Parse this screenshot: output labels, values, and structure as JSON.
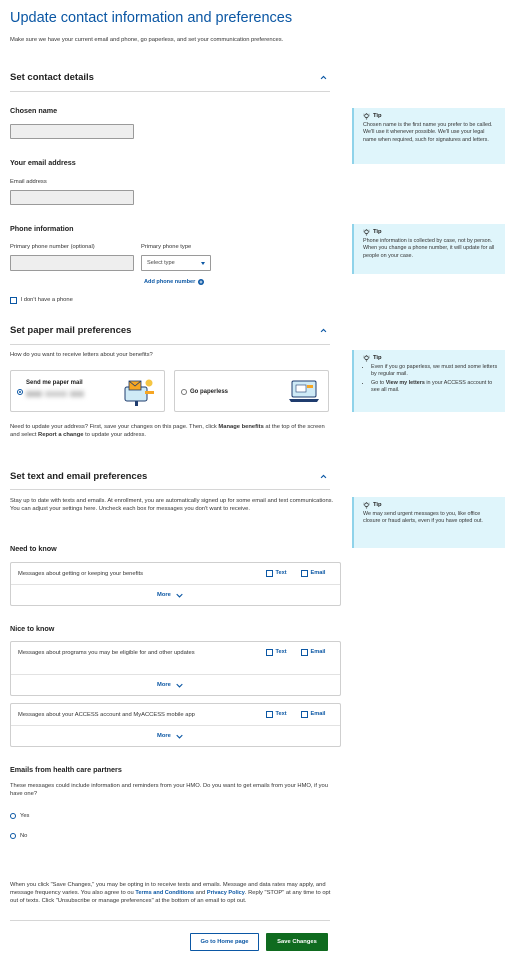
{
  "page": {
    "title": "Update contact information and preferences",
    "intro": "Make sure we have your current email and phone, go paperless, and set your communication preferences."
  },
  "contact": {
    "section_title": "Set contact details",
    "chosen_name_label": "Chosen name",
    "chosen_name_value": "",
    "email_heading": "Your email address",
    "email_label": "Email address",
    "email_value": "",
    "phone_heading": "Phone information",
    "primary_phone_label": "Primary phone number (optional)",
    "primary_phone_value": "",
    "phone_type_label": "Primary phone type",
    "phone_type_value": "Select type",
    "add_phone_link": "Add phone number",
    "no_phone_label": "I don't have a phone",
    "no_phone_checked": false
  },
  "tips": {
    "label": "Tip",
    "chosen_name": "Chosen name is the first name you prefer to be called. We'll use it whenever possible. We'll use your legal name when required, such for signatures and letters.",
    "phone": "Phone information is collected by case, not by person. When you change a phone number, it will update for all people on your case.",
    "paperless_1": "Even if you go paperless, we must send some letters by regular mail.",
    "paperless_2_pre": "Go to ",
    "paperless_2_link": "View my letters",
    "paperless_2_post": " in your ACCESS account to see all mail.",
    "text_email": "We may send urgent messages to you, like office closure or fraud alerts, even if you have opted out."
  },
  "paper": {
    "section_title": "Set paper mail preferences",
    "question": "How do you want to receive letters about your benefits?",
    "option_mail": "Send me paper mail",
    "option_paperless": "Go paperless",
    "selected": "mail",
    "address_note_1": "Need to update your address? First, save your changes on this page. Then, click ",
    "address_note_b1": "Manage benefits",
    "address_note_2": " at the top of the screen and select ",
    "address_note_b2": "Report a change",
    "address_note_3": " to update your address."
  },
  "textemail": {
    "section_title": "Set text and email preferences",
    "intro": "Stay up to date with texts and emails. At enrollment, you are automatically signed up for some email and text communications. You can adjust your settings here. Uncheck each box for messages you don't want to receive.",
    "need_to_know": "Need to know",
    "nice_to_know": "Nice to know",
    "text_label": "Text",
    "email_label": "Email",
    "more_label": "More",
    "msg_benefits": "Messages about getting or keeping your benefits",
    "msg_programs": "Messages about programs you may be eligible for and other updates",
    "msg_account": "Messages about your ACCESS account and MyACCESS mobile app"
  },
  "health": {
    "title": "Emails from health care partners",
    "question": "These messages could include information and reminders from your HMO. Do you want to get emails from your HMO, if you have one?",
    "yes": "Yes",
    "no": "No"
  },
  "footer": {
    "disclaimer_1": "When you click \"Save Changes,\" you may be opting in to receive texts and emails. Message and data rates may apply, and message frequency varies. You also agree to ou ",
    "terms": "Terms and Conditions",
    "and": " and ",
    "privacy": "Privacy Policy",
    "disclaimer_2": ". Reply \"STOP\" at any time to opt out of texts. Click \"Unsubscribe or manage preferences\" at the bottom of an email to opt out.",
    "home_button": "Go to Home page",
    "save_button": "Save Changes"
  },
  "colors": {
    "accent": "#0b57a4",
    "tip_bg": "#dff5fb",
    "save_bg": "#0f6b1f"
  }
}
